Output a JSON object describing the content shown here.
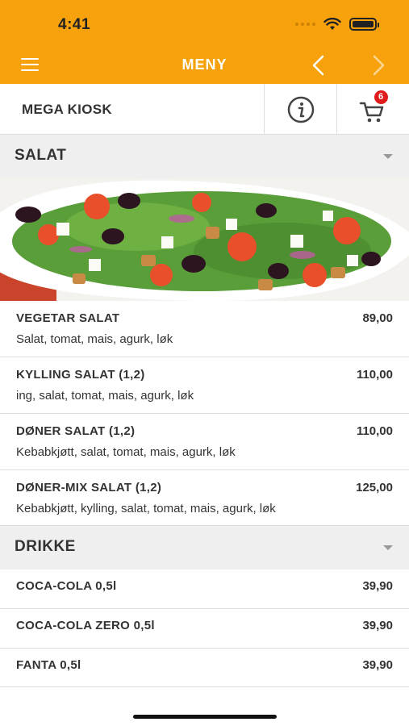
{
  "status": {
    "time": "4:41"
  },
  "nav": {
    "title": "MENY"
  },
  "restaurant": {
    "name": "MEGA KIOSK",
    "cart_count": "6"
  },
  "colors": {
    "accent": "#f7a20d",
    "badge": "#e01b1b"
  },
  "categories": [
    {
      "title": "SALAT",
      "items": [
        {
          "name": "VEGETAR SALAT",
          "price": "89,00",
          "desc": "Salat, tomat, mais, agurk, løk"
        },
        {
          "name": "KYLLING SALAT (1,2)",
          "price": "110,00",
          "desc": "ing, salat, tomat, mais, agurk, løk"
        },
        {
          "name": "DØNER SALAT (1,2)",
          "price": "110,00",
          "desc": "Kebabkjøtt, salat, tomat, mais, agurk, løk"
        },
        {
          "name": "DØNER-MIX SALAT (1,2)",
          "price": "125,00",
          "desc": "Kebabkjøtt, kylling, salat, tomat, mais, agurk, løk"
        }
      ]
    },
    {
      "title": "DRIKKE",
      "items": [
        {
          "name": "COCA-COLA 0,5l",
          "price": "39,90"
        },
        {
          "name": "COCA-COLA ZERO 0,5l",
          "price": "39,90"
        },
        {
          "name": "FANTA 0,5l",
          "price": "39,90"
        }
      ]
    }
  ]
}
